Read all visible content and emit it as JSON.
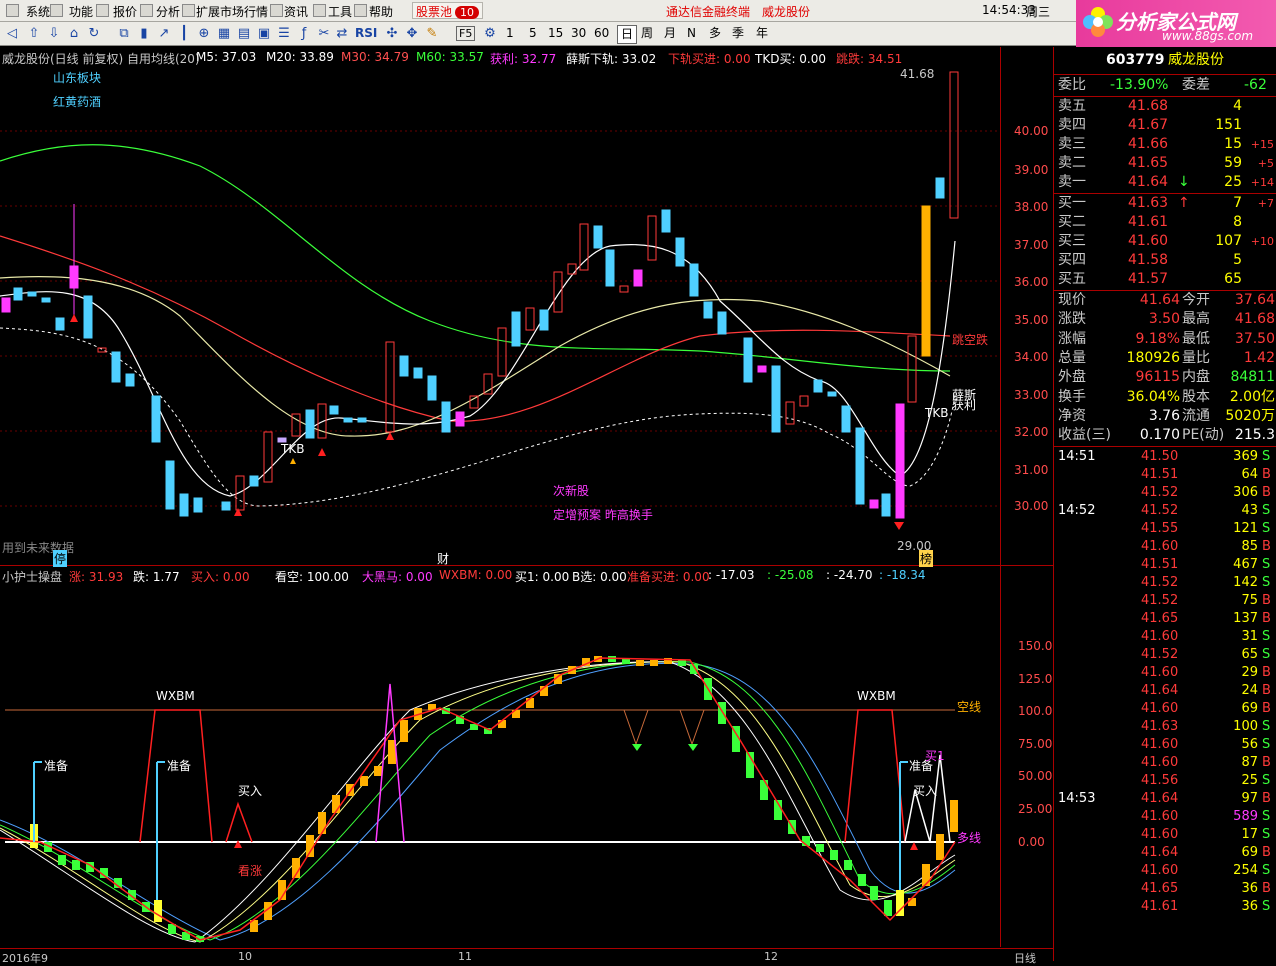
{
  "menu": [
    "系统",
    "功能",
    "报价",
    "分析",
    "扩展市场行情",
    "资讯",
    "工具",
    "帮助"
  ],
  "stock_pool": {
    "label": "股票池",
    "count": "10"
  },
  "title_app": "通达信金融终端",
  "title_stock": "威龙股份",
  "clock": "14:54:33",
  "weekday": "周三",
  "toolbar": {
    "rsi": "RSI",
    "f5": "F5",
    "periods": [
      "1",
      "5",
      "15",
      "30",
      "60",
      "日",
      "周",
      "月",
      "N",
      "多",
      "季",
      "年"
    ],
    "selected": "日"
  },
  "logo": {
    "name": "分析家公式网",
    "url": "www.88gs.com"
  },
  "main_header": {
    "title": "威龙股份(日线 前复权) 自用均线(20)",
    "m5": "M5: 37.03",
    "m20": "M20: 33.89",
    "m30": "M30: 34.79",
    "m60": "M60: 33.57",
    "profit": "获利: 32.77",
    "xue": "薛斯下轨: 33.02",
    "lower_buy": "下轨买进: 0.00",
    "tkd": "TKD买: 0.00",
    "drop": "跳跌: 34.51"
  },
  "main_overlay": {
    "sector1": "山东板块",
    "sector2": "红黄药酒",
    "future": "用到未来数据",
    "new_stock": "次新股",
    "plan": "定增预案 昨高换手",
    "tkb_left": "TKB",
    "tkb_right": "TKB",
    "jump_short": "跳空跌",
    "xue_label": "薛斯",
    "profit_label": "获利",
    "high_mark": "41.68",
    "low_mark": "29.00",
    "events": [
      "停",
      "财",
      "榜"
    ]
  },
  "main_axis": [
    "40.00",
    "39.00",
    "38.00",
    "37.00",
    "36.00",
    "35.00",
    "34.00",
    "33.00",
    "32.00",
    "31.00",
    "30.00"
  ],
  "sub_header": {
    "name": "小护士操盘",
    "rise": "涨: 31.93",
    "fall": "跌: 1.77",
    "buy": "买入: 0.00",
    "bear": "看空: 100.00",
    "bigblack": "大黑马: 0.00",
    "wxbm": "WXBM: 0.00",
    "buy1": "买1: 0.00",
    "bsel": "B选: 0.00",
    "prep": "准备买进: 0.00",
    "v1": ": -17.03",
    "v2": ": -25.08",
    "v3": ": -24.70",
    "v4": ": -18.34"
  },
  "sub_overlay": {
    "wxbm1": "WXBM",
    "wxbm2": "WXBM",
    "prep1": "准备",
    "prep2": "准备",
    "prep3": "准备",
    "buy_in": "买入",
    "kanzhang": "看涨",
    "buy_r1": "买1",
    "buy_r2": "买入",
    "empty_line": "空线",
    "long_line": "多线"
  },
  "sub_axis": [
    "150.0",
    "125.0",
    "100.0",
    "75.00",
    "50.00",
    "25.00",
    "0.00"
  ],
  "time_axis": [
    "2016年9",
    "10",
    "11",
    "12"
  ],
  "daily_tab": "日线",
  "quote": {
    "code": "603779",
    "name": "威龙股份",
    "webi_label": "委比",
    "webi": "-13.90%",
    "wecha_label": "委差",
    "wecha": "-62",
    "sells": [
      {
        "label": "卖五",
        "price": "41.68",
        "vol": "4",
        "chg": ""
      },
      {
        "label": "卖四",
        "price": "41.67",
        "vol": "151",
        "chg": ""
      },
      {
        "label": "卖三",
        "price": "41.66",
        "vol": "15",
        "chg": "+15"
      },
      {
        "label": "卖二",
        "price": "41.65",
        "vol": "59",
        "chg": "+5"
      },
      {
        "label": "卖一",
        "price": "41.64",
        "vol": "25",
        "chg": "+14"
      }
    ],
    "buys": [
      {
        "label": "买一",
        "price": "41.63",
        "vol": "7",
        "chg": "+7"
      },
      {
        "label": "买二",
        "price": "41.61",
        "vol": "8",
        "chg": ""
      },
      {
        "label": "买三",
        "price": "41.60",
        "vol": "107",
        "chg": "+10"
      },
      {
        "label": "买四",
        "price": "41.58",
        "vol": "5",
        "chg": ""
      },
      {
        "label": "买五",
        "price": "41.57",
        "vol": "65",
        "chg": ""
      }
    ],
    "stats": [
      {
        "l1": "现价",
        "v1": "41.64",
        "l2": "今开",
        "v2": "37.64",
        "c1": "#ff3a3a",
        "c2": "#ff3a3a"
      },
      {
        "l1": "涨跌",
        "v1": "3.50",
        "l2": "最高",
        "v2": "41.68",
        "c1": "#ff3a3a",
        "c2": "#ff3a3a"
      },
      {
        "l1": "涨幅",
        "v1": "9.18%",
        "l2": "最低",
        "v2": "37.50",
        "c1": "#ff3a3a",
        "c2": "#ff3a3a"
      },
      {
        "l1": "总量",
        "v1": "180926",
        "l2": "量比",
        "v2": "1.42",
        "c1": "#ffff00",
        "c2": "#ff3a3a"
      },
      {
        "l1": "外盘",
        "v1": "96115",
        "l2": "内盘",
        "v2": "84811",
        "c1": "#ff3a3a",
        "c2": "#3aff3a"
      },
      {
        "l1": "换手",
        "v1": "36.04%",
        "l2": "股本",
        "v2": "2.00亿",
        "c1": "#ffff00",
        "c2": "#ffff00"
      },
      {
        "l1": "净资",
        "v1": "3.76",
        "l2": "流通",
        "v2": "5020万",
        "c1": "#ffffff",
        "c2": "#ffff00"
      },
      {
        "l1": "收益(三)",
        "v1": "0.170",
        "l2": "PE(动)",
        "v2": "215.3",
        "c1": "#ffffff",
        "c2": "#ffffff"
      }
    ],
    "ticks": [
      {
        "t": "14:51",
        "p": "41.50",
        "v": "369",
        "s": "S"
      },
      {
        "t": "",
        "p": "41.51",
        "v": "64",
        "s": "B"
      },
      {
        "t": "",
        "p": "41.52",
        "v": "306",
        "s": "B"
      },
      {
        "t": "14:52",
        "p": "41.52",
        "v": "43",
        "s": "S"
      },
      {
        "t": "",
        "p": "41.55",
        "v": "121",
        "s": "S"
      },
      {
        "t": "",
        "p": "41.60",
        "v": "85",
        "s": "B"
      },
      {
        "t": "",
        "p": "41.51",
        "v": "467",
        "s": "S"
      },
      {
        "t": "",
        "p": "41.52",
        "v": "142",
        "s": "S"
      },
      {
        "t": "",
        "p": "41.52",
        "v": "75",
        "s": "B"
      },
      {
        "t": "",
        "p": "41.65",
        "v": "137",
        "s": "B"
      },
      {
        "t": "",
        "p": "41.60",
        "v": "31",
        "s": "S"
      },
      {
        "t": "",
        "p": "41.52",
        "v": "65",
        "s": "S"
      },
      {
        "t": "",
        "p": "41.60",
        "v": "29",
        "s": "B"
      },
      {
        "t": "",
        "p": "41.64",
        "v": "24",
        "s": "B"
      },
      {
        "t": "",
        "p": "41.60",
        "v": "69",
        "s": "B"
      },
      {
        "t": "",
        "p": "41.63",
        "v": "100",
        "s": "S"
      },
      {
        "t": "",
        "p": "41.60",
        "v": "56",
        "s": "S"
      },
      {
        "t": "",
        "p": "41.60",
        "v": "87",
        "s": "B"
      },
      {
        "t": "",
        "p": "41.56",
        "v": "25",
        "s": "S"
      },
      {
        "t": "14:53",
        "p": "41.64",
        "v": "97",
        "s": "B"
      },
      {
        "t": "",
        "p": "41.60",
        "v": "589",
        "s": "S"
      },
      {
        "t": "",
        "p": "41.60",
        "v": "17",
        "s": "S"
      },
      {
        "t": "",
        "p": "41.64",
        "v": "69",
        "s": "B"
      },
      {
        "t": "",
        "p": "41.60",
        "v": "254",
        "s": "S"
      },
      {
        "t": "",
        "p": "41.65",
        "v": "36",
        "s": "B"
      },
      {
        "t": "",
        "p": "41.61",
        "v": "36",
        "s": "S"
      }
    ]
  }
}
